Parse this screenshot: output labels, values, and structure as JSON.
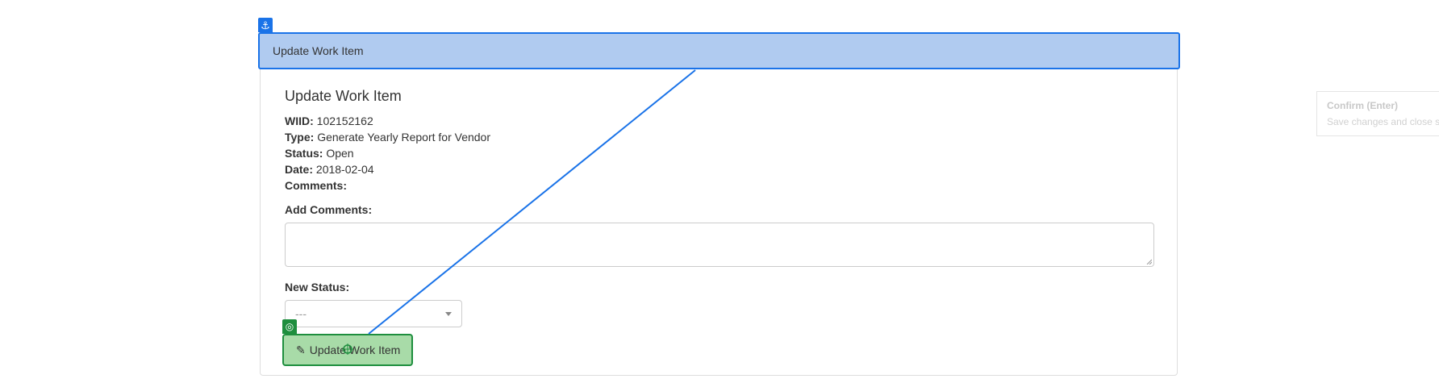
{
  "panel": {
    "heading": "Update Work Item",
    "title": "Update Work Item"
  },
  "details": [
    {
      "label": "WIID:",
      "value": "102152162"
    },
    {
      "label": "Type:",
      "value": "Generate Yearly Report for Vendor"
    },
    {
      "label": "Status:",
      "value": "Open"
    },
    {
      "label": "Date:",
      "value": "2018-02-04"
    },
    {
      "label": "Comments:",
      "value": ""
    }
  ],
  "form": {
    "add_comments_label": "Add Comments:",
    "add_comments_value": "",
    "new_status_label": "New Status:",
    "new_status_selected": "---"
  },
  "button": {
    "label": "Update Work Item",
    "icon": "pencil-icon"
  },
  "overlay": {
    "anchor_icon": "anchor-icon",
    "target_icon": "target-icon",
    "accent_color": "#1a73e8",
    "target_color": "#1e8e3e"
  },
  "tooltip": {
    "title": "Confirm (Enter)",
    "text": "Save changes and close se"
  }
}
